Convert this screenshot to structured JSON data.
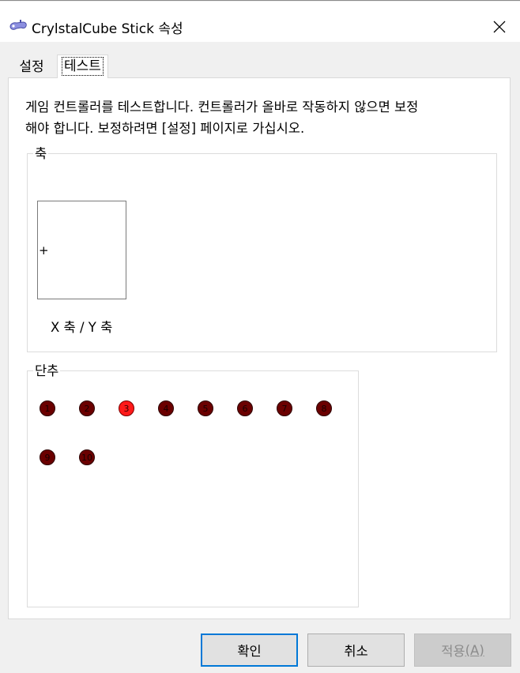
{
  "window": {
    "title": "CrylstalCube Stick 속성"
  },
  "tabs": [
    {
      "label": "설정",
      "active": false
    },
    {
      "label": "테스트",
      "active": true
    }
  ],
  "description": {
    "line1": "게임 컨트롤러를 테스트합니다. 컨트롤러가 올바로 작동하지 않으면 보정",
    "line2": "해야 합니다. 보정하려면 [설정] 페이지로 가십시오."
  },
  "axis_group": {
    "title": "축",
    "xy_label": "X 축 / Y 축",
    "crosshair": "+"
  },
  "buttons_group": {
    "title": "단추",
    "buttons": [
      {
        "label": "1",
        "pressed": false
      },
      {
        "label": "2",
        "pressed": false
      },
      {
        "label": "3",
        "pressed": true
      },
      {
        "label": "4",
        "pressed": false
      },
      {
        "label": "5",
        "pressed": false
      },
      {
        "label": "6",
        "pressed": false
      },
      {
        "label": "7",
        "pressed": false
      },
      {
        "label": "8",
        "pressed": false
      },
      {
        "label": "9",
        "pressed": false
      },
      {
        "label": "10",
        "pressed": false
      }
    ],
    "colors": {
      "idle": "#6b0000",
      "pressed": "#ff1a1a"
    }
  },
  "footer": {
    "ok_label": "확인",
    "cancel_label": "취소",
    "apply_label": "적용",
    "apply_accel": "(A)",
    "apply_enabled": false
  },
  "icons": {
    "app": "joystick-icon",
    "close": "close-icon"
  },
  "colors": {
    "focus_border": "#0078d7",
    "window_bg": "#f0f0f0",
    "panel_bg": "#ffffff"
  }
}
